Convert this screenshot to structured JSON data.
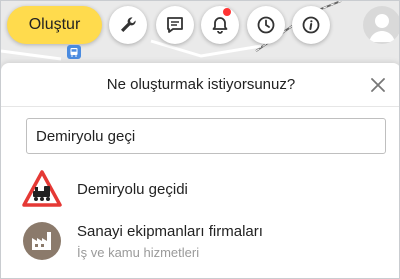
{
  "toolbar": {
    "create_label": "Oluştur",
    "tools": [
      {
        "icon": "wrench-icon"
      },
      {
        "icon": "message-icon"
      },
      {
        "icon": "bell-icon",
        "has_notification": true
      },
      {
        "icon": "clock-icon"
      },
      {
        "icon": "info-icon"
      }
    ],
    "avatar_icon": "user-avatar-icon"
  },
  "panel": {
    "title": "Ne oluşturmak istiyorsunuz?",
    "close_icon": "close-icon"
  },
  "search": {
    "value": "Demiryolu geçi"
  },
  "results": [
    {
      "title": "Demiryolu geçidi",
      "subtitle": "",
      "icon": "railway-crossing-icon"
    },
    {
      "title": "Sanayi ekipmanları firmaları",
      "subtitle": "İş ve kamu hizmetleri",
      "icon": "factory-icon"
    }
  ],
  "colors": {
    "accent_yellow": "#ffdb4d",
    "notification_red": "#ff3333",
    "warning_red": "#e53935",
    "icon_brown": "#8b7a6b"
  }
}
